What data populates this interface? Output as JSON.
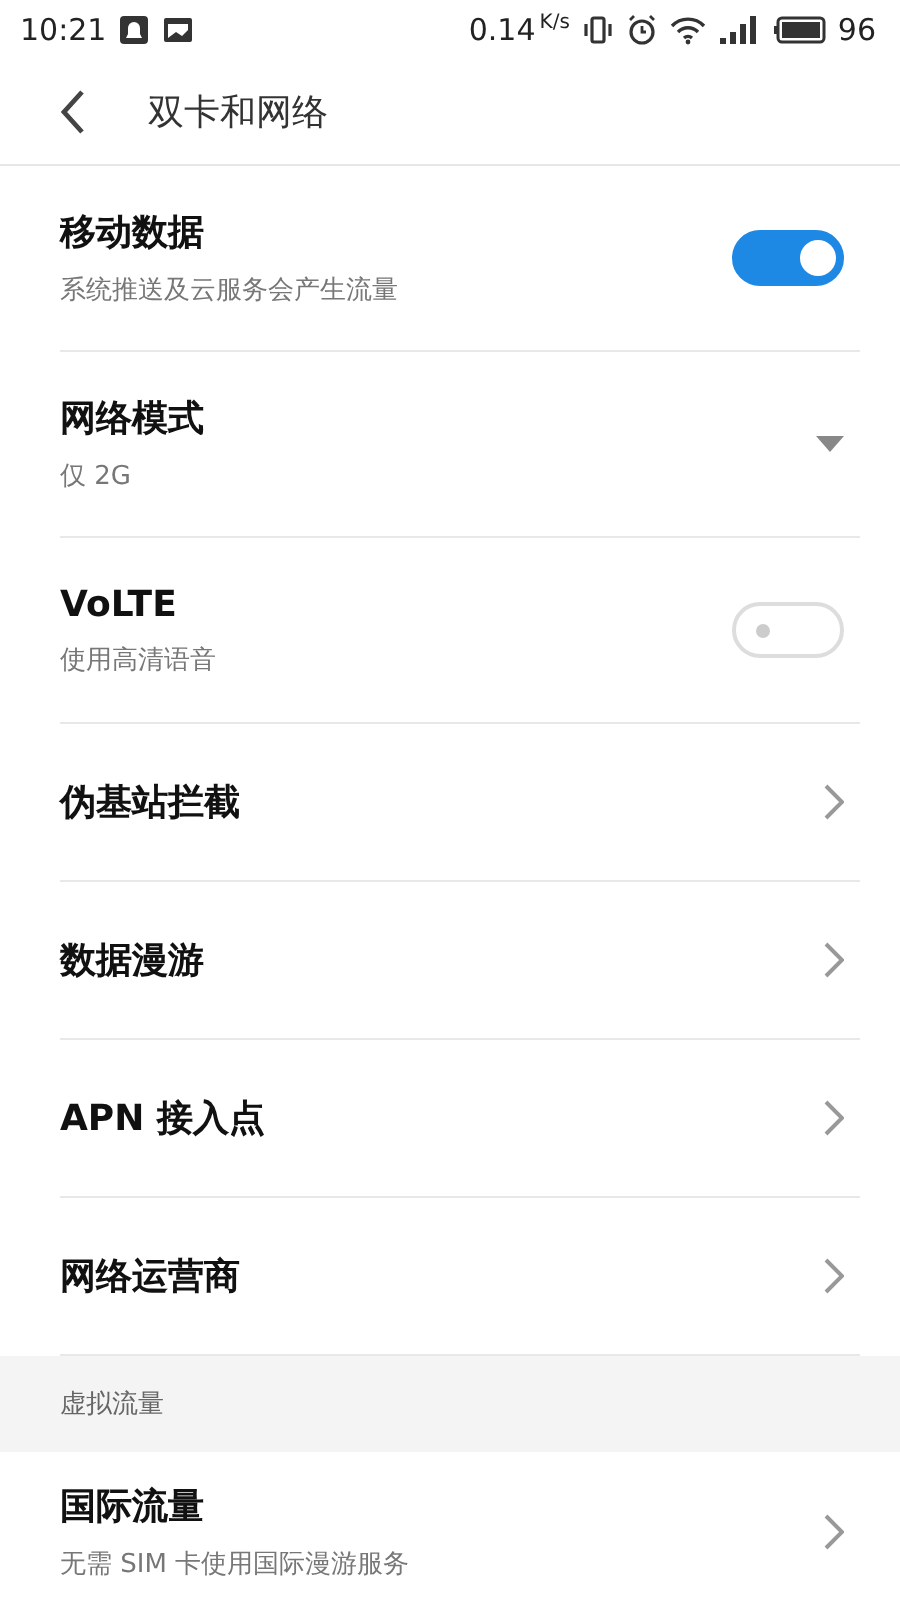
{
  "status_bar": {
    "time": "10:21",
    "speed": "0.14",
    "speed_unit": "K/s",
    "battery": "96"
  },
  "header": {
    "title": "双卡和网络"
  },
  "rows": [
    {
      "kind": "toggle",
      "title": "移动数据",
      "subtitle": "系统推送及云服务会产生流量",
      "on": true
    },
    {
      "kind": "dropdown",
      "title": "网络模式",
      "subtitle": "仅 2G"
    },
    {
      "kind": "toggle",
      "title": "VoLTE",
      "subtitle": "使用高清语音",
      "on": false
    },
    {
      "kind": "link",
      "title": "伪基站拦截"
    },
    {
      "kind": "link",
      "title": "数据漫游"
    },
    {
      "kind": "link",
      "title": "APN 接入点"
    },
    {
      "kind": "link",
      "title": "网络运营商"
    }
  ],
  "section": {
    "title": "虚拟流量",
    "rows": [
      {
        "kind": "link",
        "title": "国际流量",
        "subtitle": "无需 SIM 卡使用国际漫游服务"
      }
    ]
  }
}
